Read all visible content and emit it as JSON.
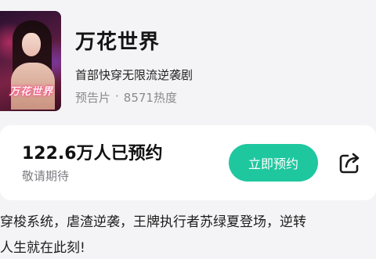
{
  "show": {
    "poster_title": "万花世界",
    "title": "万花世界",
    "subtitle": "首部快穿无限流逆袭剧",
    "type": "预告片",
    "separator": "·",
    "heat": "8571热度"
  },
  "reservation": {
    "count": "122.6万人已预约",
    "hint": "敬请期待",
    "button_label": "立即预约",
    "button_color": "#1fc79f"
  },
  "share": {
    "icon": "share-icon"
  },
  "description": {
    "line1": "穿梭系统，虐渣逆袭，王牌执行者苏绿夏登场，逆转",
    "line2": "人生就在此刻!"
  }
}
